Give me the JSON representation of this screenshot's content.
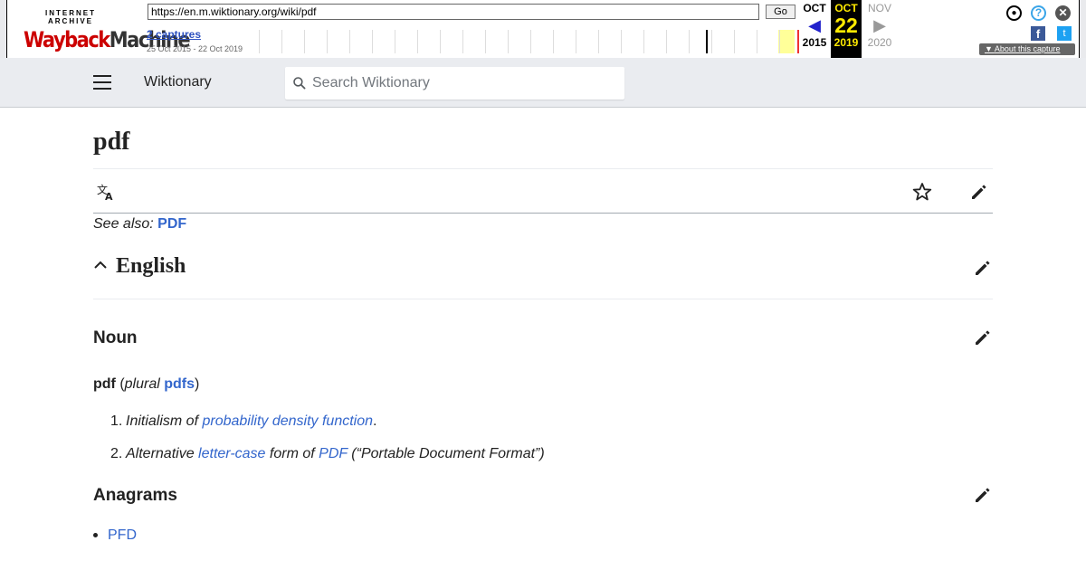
{
  "wayback": {
    "logo_top": "INTERNET ARCHIVE",
    "logo_main_1": "Wayback",
    "logo_main_2": "Machine",
    "url": "https://en.m.wiktionary.org/wiki/pdf",
    "go_label": "Go",
    "captures_link": "2 captures",
    "capture_range": "25 Oct 2015 - 22 Oct 2019",
    "prev": {
      "month": "OCT",
      "year": "2015"
    },
    "current": {
      "month": "OCT",
      "day": "22",
      "year": "2019"
    },
    "next": {
      "month": "NOV",
      "year": "2020"
    },
    "about_label": "About this capture",
    "icons": [
      "user-icon",
      "help-icon",
      "close-icon",
      "facebook-icon",
      "twitter-icon"
    ]
  },
  "header": {
    "brand": "Wiktionary",
    "search_placeholder": "Search Wiktionary"
  },
  "page": {
    "title": "pdf",
    "see_also_label": "See also:",
    "see_also_link": "PDF"
  },
  "sections": {
    "english": "English",
    "noun": "Noun",
    "anagrams": "Anagrams"
  },
  "headword": {
    "word": "pdf",
    "open_paren": "(",
    "plural_label": "plural",
    "plural_form": "pdfs",
    "close_paren": ")"
  },
  "definitions": [
    {
      "num": "1.",
      "pre": "Initialism of ",
      "link": "probability density function",
      "post": "."
    },
    {
      "num": "2.",
      "pre": "Alternative ",
      "link": "letter-case",
      "mid": " form of ",
      "link2": "PDF",
      "post": " (“Portable Document Format”)"
    }
  ],
  "anagrams": [
    "PFD"
  ],
  "colors": {
    "link": "#3366cc",
    "header_bg": "#eaecf0",
    "wayback_current": "#ffea00"
  }
}
